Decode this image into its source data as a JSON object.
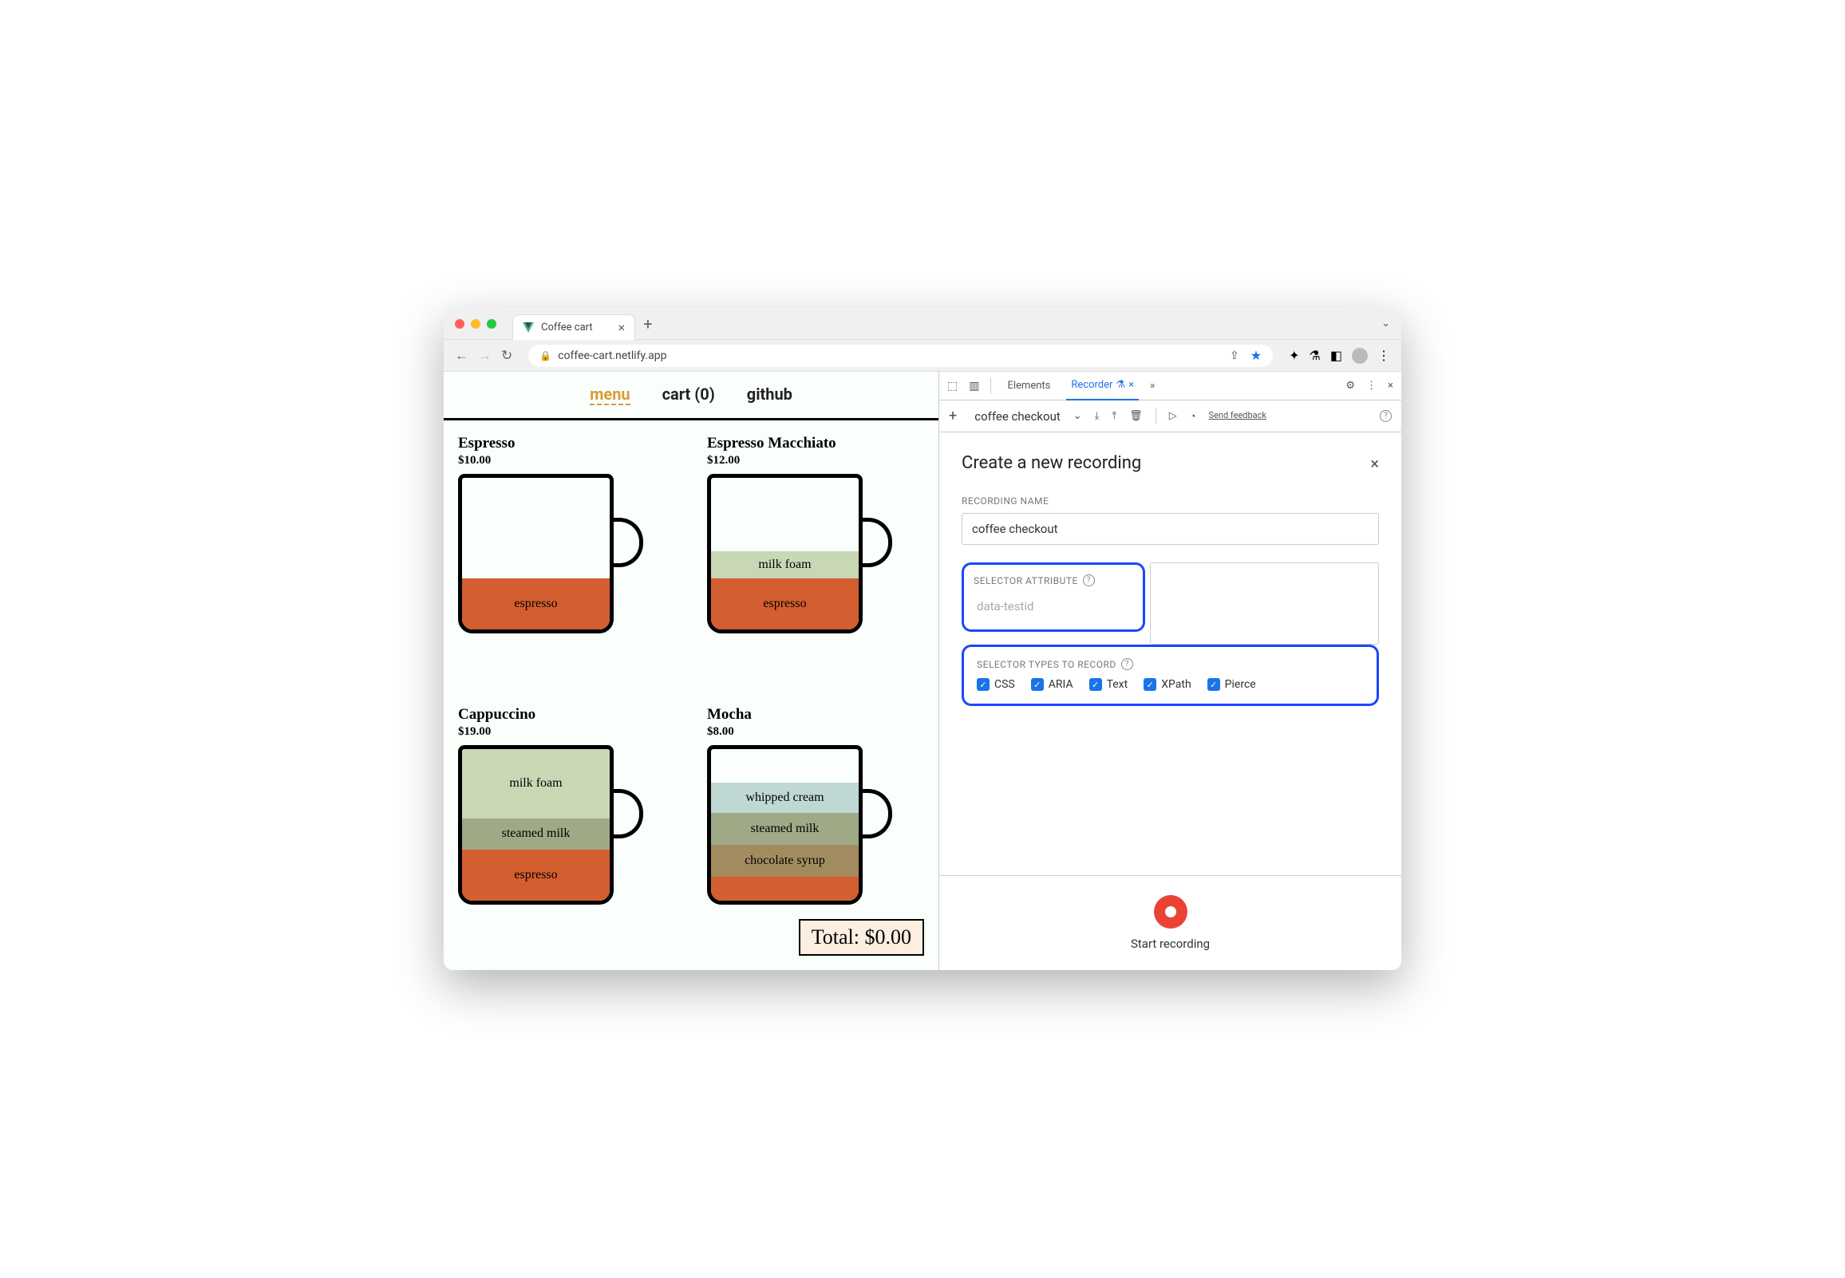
{
  "browser": {
    "tab_title": "Coffee cart",
    "url": "coffee-cart.netlify.app"
  },
  "page": {
    "nav": {
      "menu": "menu",
      "cart": "cart (0)",
      "github": "github"
    },
    "products": [
      {
        "name": "Espresso",
        "price": "$10.00"
      },
      {
        "name": "Espresso Macchiato",
        "price": "$12.00"
      },
      {
        "name": "Cappuccino",
        "price": "$19.00"
      },
      {
        "name": "Mocha",
        "price": "$8.00"
      }
    ],
    "layers": {
      "espresso": "espresso",
      "milk_foam": "milk foam",
      "steamed_milk": "steamed milk",
      "whipped_cream": "whipped cream",
      "chocolate_syrup": "chocolate syrup"
    },
    "total": "Total: $0.00"
  },
  "devtools": {
    "tabs": {
      "elements": "Elements",
      "recorder": "Recorder"
    },
    "toolbar": {
      "recording_name": "coffee checkout",
      "feedback": "Send feedback"
    },
    "panel": {
      "title": "Create a new recording",
      "recording_name_label": "RECORDING NAME",
      "recording_name_value": "coffee checkout",
      "selector_attr_label": "SELECTOR ATTRIBUTE",
      "selector_attr_placeholder": "data-testid",
      "selector_types_label": "SELECTOR TYPES TO RECORD",
      "types": {
        "css": "CSS",
        "aria": "ARIA",
        "text": "Text",
        "xpath": "XPath",
        "pierce": "Pierce"
      },
      "start": "Start recording"
    }
  }
}
